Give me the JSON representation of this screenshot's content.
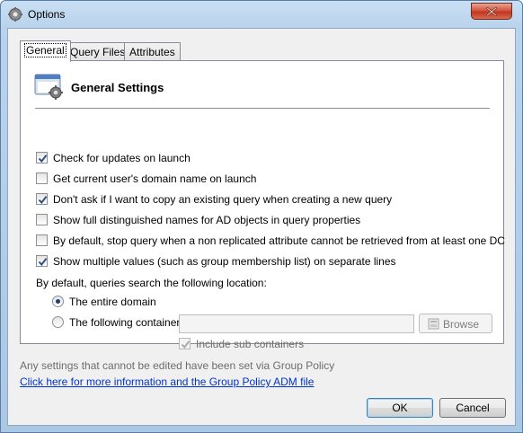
{
  "window": {
    "title": "Options",
    "icon": "gear-icon"
  },
  "tabs": [
    {
      "label": "General",
      "active": true
    },
    {
      "label": "Query Files",
      "active": false
    },
    {
      "label": "Attributes",
      "active": false
    }
  ],
  "section": {
    "title": "General Settings",
    "icon": "settings-window-icon"
  },
  "options": [
    {
      "label": "Check for updates on launch",
      "checked": true
    },
    {
      "label": "Get current user's domain name on launch",
      "checked": false
    },
    {
      "label": "Don't ask if I want to copy an existing query when creating a new query",
      "checked": true
    },
    {
      "label": "Show full distinguished names for AD objects in query properties",
      "checked": false
    },
    {
      "label": "By default, stop query when a non replicated attribute cannot be retrieved from at least one DC",
      "checked": false
    },
    {
      "label": "Show multiple values (such as group membership list) on separate lines",
      "checked": true
    }
  ],
  "search_location": {
    "label": "By default, queries search the following location:",
    "entire_domain": {
      "label": "The entire domain",
      "selected": true
    },
    "following_container": {
      "label": "The following container:",
      "selected": false,
      "value": ""
    },
    "browse_label": "Browse",
    "include_sub": {
      "label": "Include sub containers",
      "checked": true,
      "disabled": true
    }
  },
  "footer": {
    "note": "Any settings that cannot be edited have been set via Group Policy",
    "link": "Click here for more information and the Group Policy ADM file"
  },
  "buttons": {
    "ok": "OK",
    "cancel": "Cancel"
  },
  "colors": {
    "link": "#0033cc",
    "close": "#c3361f",
    "title_bar": "#b9d3ec"
  }
}
